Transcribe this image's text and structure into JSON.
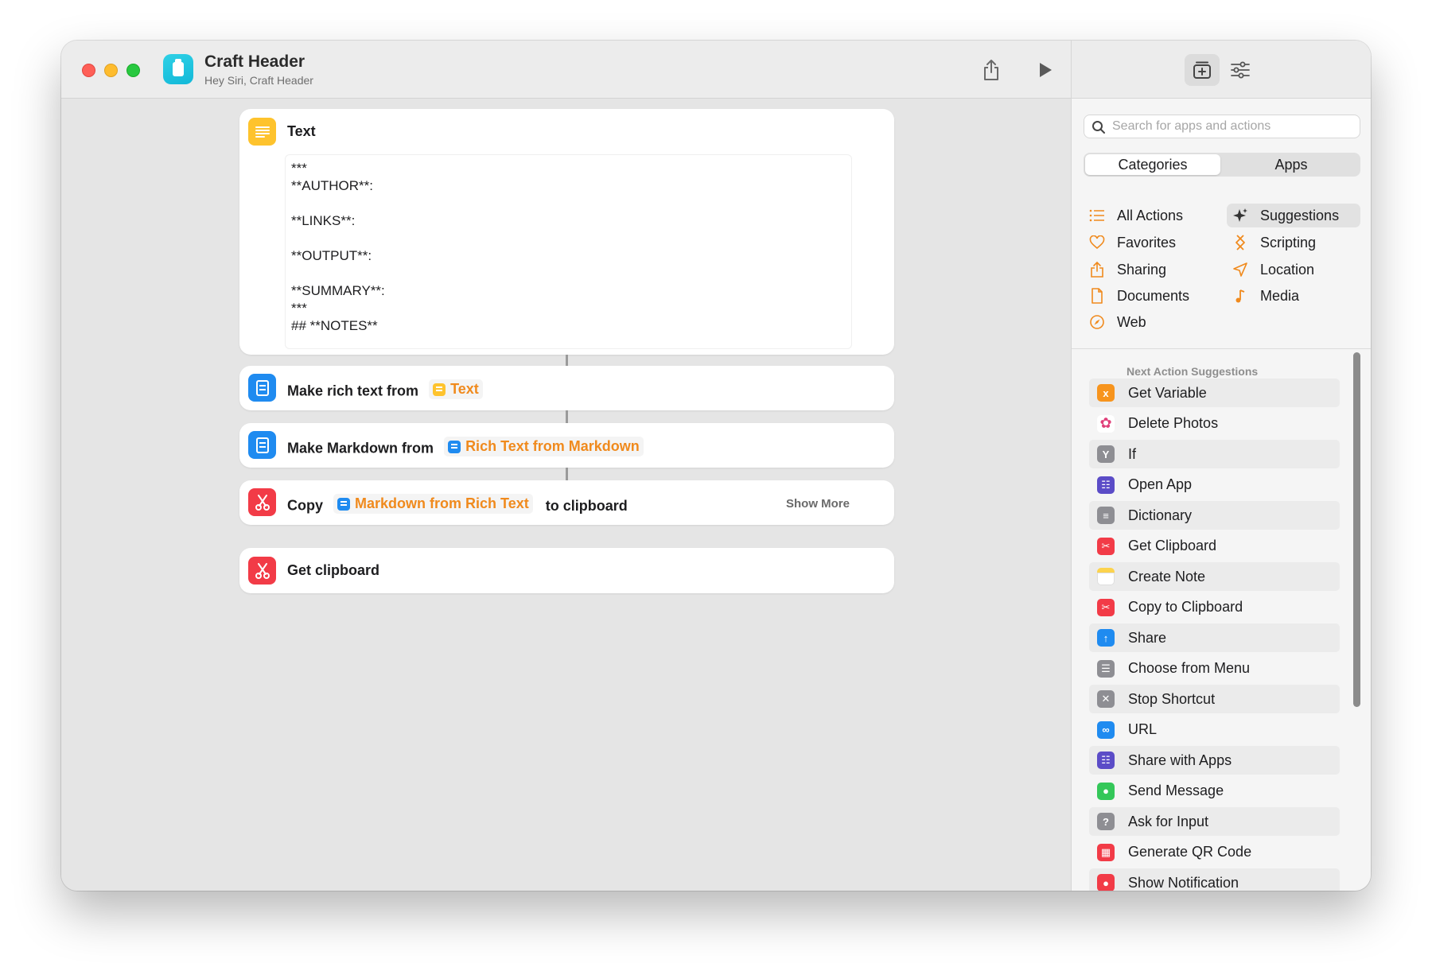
{
  "window": {
    "title": "Craft Header",
    "subtitle": "Hey Siri, Craft Header"
  },
  "editor": {
    "text_action": {
      "title": "Text",
      "body": "***\n**AUTHOR**:\n\n**LINKS**:\n\n**OUTPUT**:\n\n**SUMMARY**:\n***\n## **NOTES**"
    },
    "rich_text_action": {
      "prefix": "Make rich text from",
      "token": "Text"
    },
    "markdown_action": {
      "prefix": "Make Markdown from",
      "token": "Rich Text from Markdown"
    },
    "copy_action": {
      "prefix": "Copy",
      "token": "Markdown from Rich Text",
      "suffix": "to clipboard",
      "show_more": "Show More"
    },
    "get_clipboard_action": {
      "title": "Get clipboard"
    }
  },
  "panel": {
    "search_placeholder": "Search for apps and actions",
    "segments": [
      "Categories",
      "Apps"
    ],
    "categories": [
      {
        "label": "All Actions",
        "icon": "list-icon"
      },
      {
        "label": "Suggestions",
        "icon": "sparkles-icon",
        "selected": true
      },
      {
        "label": "Favorites",
        "icon": "heart-icon"
      },
      {
        "label": "Scripting",
        "icon": "scripting-icon"
      },
      {
        "label": "Sharing",
        "icon": "share-icon"
      },
      {
        "label": "Location",
        "icon": "location-arrow-icon"
      },
      {
        "label": "Documents",
        "icon": "document-icon"
      },
      {
        "label": "Media",
        "icon": "music-note-icon"
      },
      {
        "label": "Web",
        "icon": "compass-icon"
      }
    ],
    "suggestions_header": "Next Action Suggestions",
    "suggestions": [
      {
        "label": "Get Variable",
        "icon": "variable-icon",
        "color": "#f7941d"
      },
      {
        "label": "Delete Photos",
        "icon": "photos-icon",
        "color": "#ffffff"
      },
      {
        "label": "If",
        "icon": "if-branch-icon",
        "color": "#8e8e93"
      },
      {
        "label": "Open App",
        "icon": "app-grid-icon",
        "color": "#5b4cc7"
      },
      {
        "label": "Dictionary",
        "icon": "dictionary-icon",
        "color": "#8e8e93"
      },
      {
        "label": "Get Clipboard",
        "icon": "clipboard-scissors-icon",
        "color": "#f23b47"
      },
      {
        "label": "Create Note",
        "icon": "notes-icon",
        "color": "#fcd34d"
      },
      {
        "label": "Copy to Clipboard",
        "icon": "clipboard-scissors-icon",
        "color": "#f23b47"
      },
      {
        "label": "Share",
        "icon": "share-icon",
        "color": "#1f8bf0"
      },
      {
        "label": "Choose from Menu",
        "icon": "menu-icon",
        "color": "#8e8e93"
      },
      {
        "label": "Stop Shortcut",
        "icon": "stop-x-icon",
        "color": "#8e8e93"
      },
      {
        "label": "URL",
        "icon": "link-icon",
        "color": "#1f8bf0"
      },
      {
        "label": "Share with Apps",
        "icon": "app-grid-icon",
        "color": "#5b4cc7"
      },
      {
        "label": "Send Message",
        "icon": "messages-icon",
        "color": "#34c759"
      },
      {
        "label": "Ask for Input",
        "icon": "question-icon",
        "color": "#8e8e93"
      },
      {
        "label": "Generate QR Code",
        "icon": "qr-code-icon",
        "color": "#f23b47"
      },
      {
        "label": "Show Notification",
        "icon": "notification-icon",
        "color": "#f23b47"
      }
    ]
  },
  "colors": {
    "accent_orange": "#f08a1d",
    "text_icon_yellow": "#fec32d",
    "doc_icon_blue": "#1f8bf0",
    "scissors_red": "#f23b47"
  }
}
